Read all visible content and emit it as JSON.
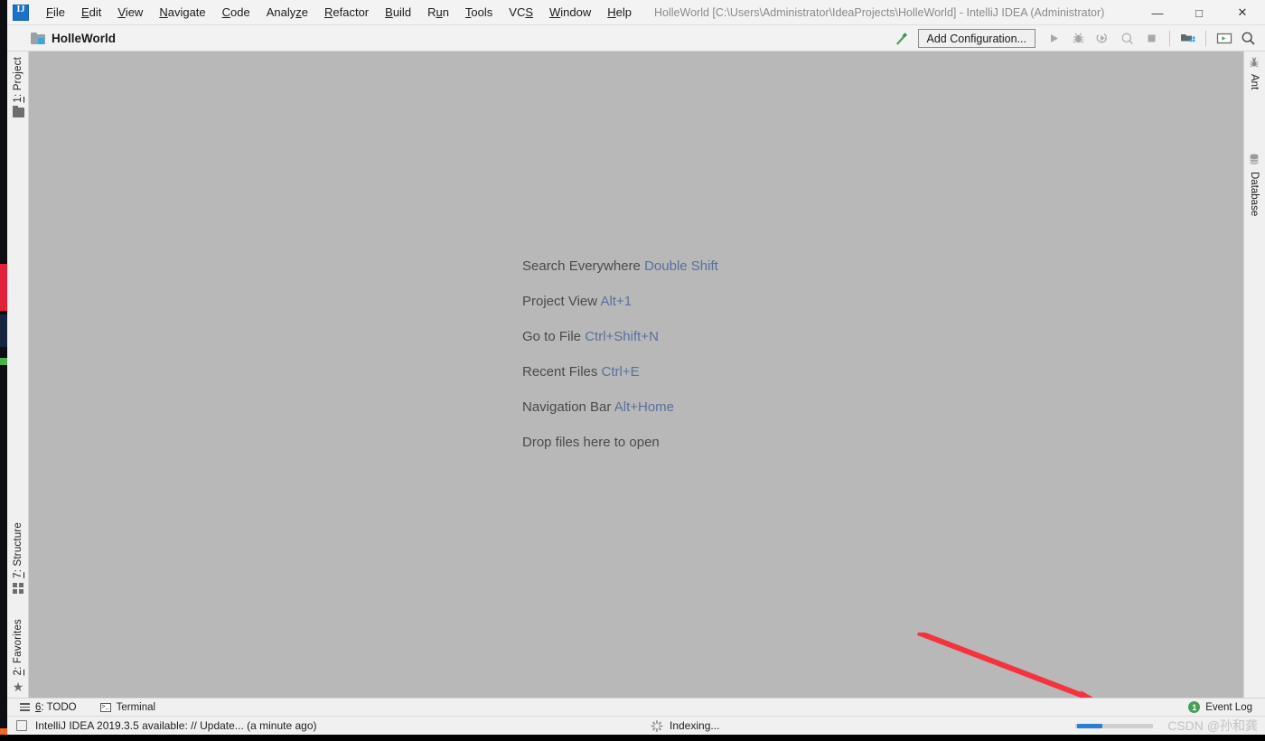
{
  "window": {
    "title": "HolleWorld [C:\\Users\\Administrator\\IdeaProjects\\HolleWorld] - IntelliJ IDEA (Administrator)",
    "app_logo_name": "intellij-idea-logo",
    "controls": {
      "minimize": "—",
      "maximize": "□",
      "close": "✕"
    }
  },
  "menu": [
    {
      "pre": "",
      "mn": "F",
      "post": "ile"
    },
    {
      "pre": "",
      "mn": "E",
      "post": "dit"
    },
    {
      "pre": "",
      "mn": "V",
      "post": "iew"
    },
    {
      "pre": "",
      "mn": "N",
      "post": "avigate"
    },
    {
      "pre": "",
      "mn": "C",
      "post": "ode"
    },
    {
      "pre": "Analy",
      "mn": "z",
      "post": "e"
    },
    {
      "pre": "",
      "mn": "R",
      "post": "efactor"
    },
    {
      "pre": "",
      "mn": "B",
      "post": "uild"
    },
    {
      "pre": "R",
      "mn": "u",
      "post": "n"
    },
    {
      "pre": "",
      "mn": "T",
      "post": "ools"
    },
    {
      "pre": "VC",
      "mn": "S",
      "post": ""
    },
    {
      "pre": "",
      "mn": "W",
      "post": "indow"
    },
    {
      "pre": "",
      "mn": "H",
      "post": "elp"
    }
  ],
  "toolbar": {
    "breadcrumb": "HolleWorld",
    "breadcrumb_icon": "project-folder-icon",
    "build_icon": "build-hammer-icon",
    "add_configuration_label": "Add Configuration...",
    "run_icon": "run-icon",
    "debug_icon": "debug-icon",
    "run_with_coverage_icon": "run-with-coverage-icon",
    "profile_icon": "profile-icon",
    "stop_icon": "stop-icon",
    "project_structure_icon": "project-structure-icon",
    "terminal_window_icon": "terminal-window-icon",
    "search_icon": "search-icon"
  },
  "left_tool_window": [
    {
      "num": "1",
      "label": ": Project",
      "icon": "folder-icon"
    },
    {
      "num": "7",
      "label": ": Structure",
      "icon": "structure-icon"
    },
    {
      "num": "2",
      "label": ": Favorites",
      "icon": "star-icon"
    }
  ],
  "right_tool_window": [
    {
      "label": "Ant",
      "icon": "ant-icon",
      "glyph": "🐜"
    },
    {
      "label": "Database",
      "icon": "database-icon",
      "glyph": ""
    }
  ],
  "editor": {
    "hints": [
      {
        "action": "Search Everywhere",
        "key": "Double Shift"
      },
      {
        "action": "Project View",
        "key": "Alt+1"
      },
      {
        "action": "Go to File",
        "key": "Ctrl+Shift+N"
      },
      {
        "action": "Recent Files",
        "key": "Ctrl+E"
      },
      {
        "action": "Navigation Bar",
        "key": "Alt+Home"
      },
      {
        "action": "Drop files here to open",
        "key": ""
      }
    ],
    "background_color": "#b8b8b8",
    "hint_key_color": "#5a6f9e"
  },
  "annotation": {
    "arrow_color": "#f5333f",
    "name": "red-pointer-arrow"
  },
  "bottom_tool_bar": {
    "todo_num": "6",
    "todo_label": ": TODO",
    "todo_icon": "todo-list-icon",
    "terminal_label": "Terminal",
    "terminal_icon": "terminal-icon",
    "event_log_label": "Event Log",
    "event_log_count": "1",
    "event_log_badge_color": "#4a9e5c"
  },
  "status_bar": {
    "message": "IntelliJ IDEA 2019.3.5 available: // Update... (a minute ago)",
    "message_icon": "notification-icon",
    "indexing_label": "Indexing...",
    "indexing_icon": "loading-spinner-icon",
    "progress_percent": 30,
    "progress_color": "#2a7fd4",
    "watermark": "CSDN @孙和龚"
  }
}
